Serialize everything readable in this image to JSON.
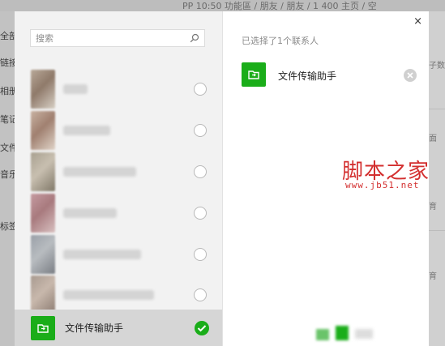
{
  "background_app": {
    "crumb": "PP 10:50 功能區 / 朋友 / 朋友 / 1 400 主页 / 空",
    "left_nav": [
      "全部",
      "链接",
      "相册",
      "笔记",
      "文件",
      "音乐",
      "标签"
    ],
    "right_labels": [
      "子数",
      "面",
      "育",
      "育"
    ]
  },
  "search": {
    "placeholder": "搜索"
  },
  "contacts": [
    {
      "avatar_colors": [
        "#b8a898",
        "#8f7a6a",
        "#d7cfc4"
      ],
      "name_width": 30,
      "selected": false
    },
    {
      "avatar_colors": [
        "#c8b2a2",
        "#a08070",
        "#e0d4c8"
      ],
      "name_width": 58,
      "selected": false
    },
    {
      "avatar_colors": [
        "#a8a090",
        "#c8bfb0",
        "#807868"
      ],
      "name_width": 90,
      "selected": false
    },
    {
      "avatar_colors": [
        "#c59aa0",
        "#a87a7e",
        "#d8c0c0"
      ],
      "name_width": 66,
      "selected": false
    },
    {
      "avatar_colors": [
        "#9aa0a8",
        "#b8bcc0",
        "#7a7e84"
      ],
      "name_width": 96,
      "selected": false
    },
    {
      "avatar_colors": [
        "#a89a90",
        "#c8b8ac",
        "#8a7a70"
      ],
      "name_width": 112,
      "selected": false
    }
  ],
  "selected_row": {
    "name": "文件传输助手"
  },
  "selected_panel": {
    "title": "已选择了1个联系人",
    "items": [
      {
        "name": "文件传输助手"
      }
    ]
  },
  "close_label": "×",
  "watermark": {
    "main": "脚本之家",
    "url": "www.jb51.net"
  },
  "colors": {
    "accent": "#1aad19",
    "watermark": "#d32f2f"
  },
  "icons": {
    "search": "search-icon",
    "file_transfer": "file-transfer-icon",
    "check": "check-icon",
    "remove": "remove-icon",
    "close": "close-icon"
  }
}
